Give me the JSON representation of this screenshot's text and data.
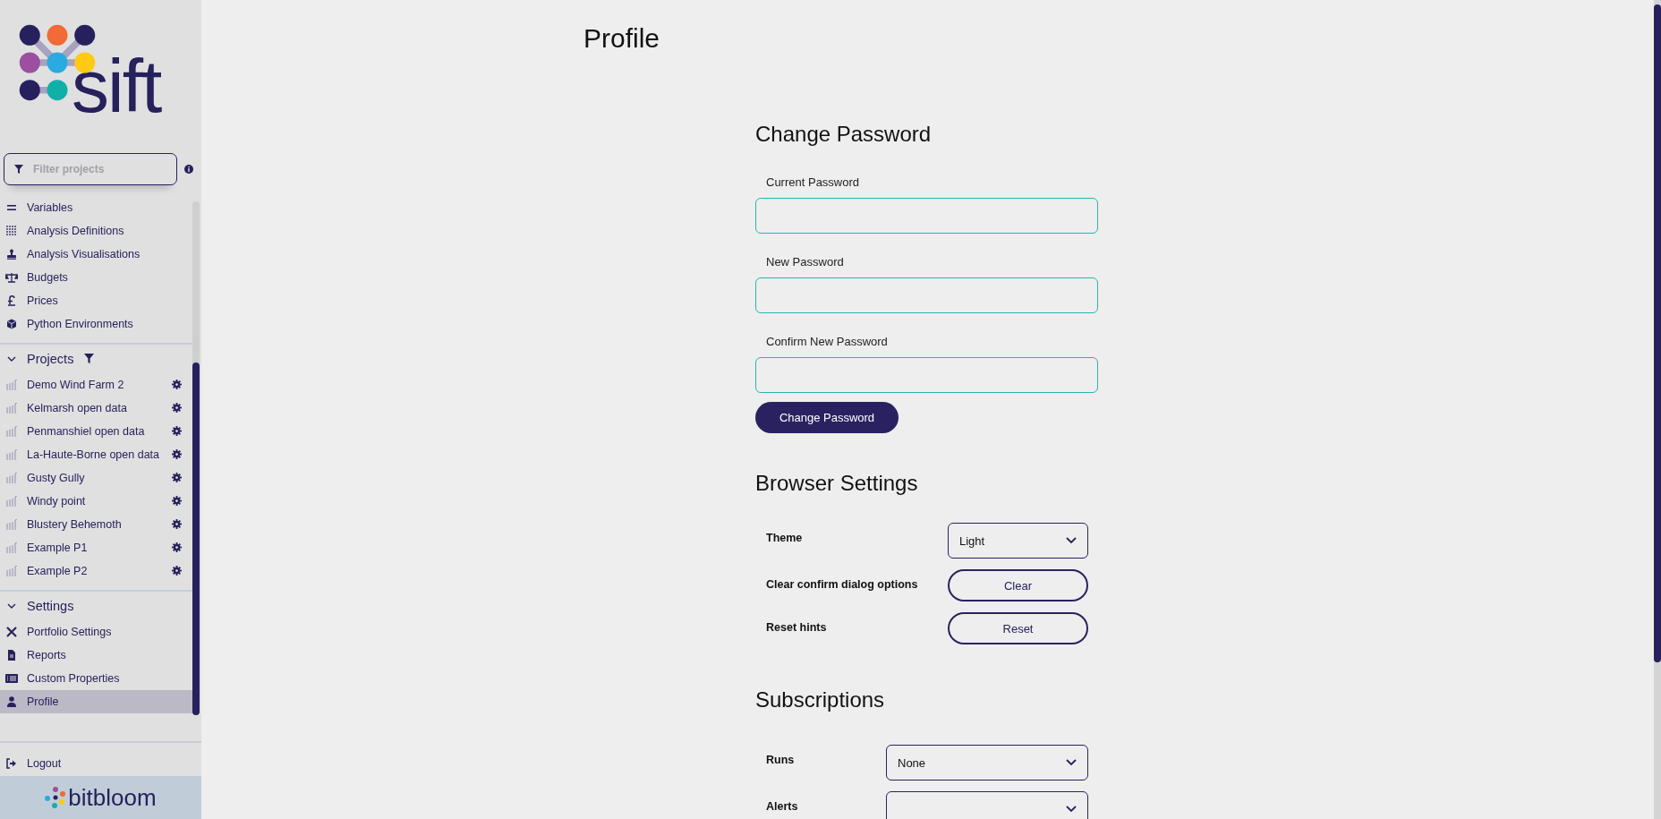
{
  "logo": {
    "text": "sift"
  },
  "filter": {
    "placeholder": "Filter projects"
  },
  "nav_items": [
    {
      "label": "Variables",
      "selected": false
    },
    {
      "label": "Analysis Definitions",
      "selected": false
    },
    {
      "label": "Analysis Visualisations",
      "selected": false
    },
    {
      "label": "Budgets",
      "selected": false
    },
    {
      "label": "Prices",
      "selected": false
    },
    {
      "label": "Python Environments",
      "selected": false
    }
  ],
  "projects": {
    "title": "Projects",
    "expanded": true,
    "items": [
      {
        "label": "Demo Wind Farm 2",
        "selected": false
      },
      {
        "label": "Kelmarsh open data",
        "selected": false
      },
      {
        "label": "Penmanshiel open data",
        "selected": false
      },
      {
        "label": "La-Haute-Borne open data",
        "selected": false
      },
      {
        "label": "Gusty Gully",
        "selected": false
      },
      {
        "label": "Windy point",
        "selected": false
      },
      {
        "label": "Blustery Behemoth",
        "selected": false
      },
      {
        "label": "Example P1",
        "selected": false
      },
      {
        "label": "Example P2",
        "selected": false
      }
    ]
  },
  "settings": {
    "title": "Settings",
    "expanded": true,
    "items": [
      {
        "label": "Portfolio Settings",
        "selected": false
      },
      {
        "label": "Reports",
        "selected": false
      },
      {
        "label": "Custom Properties",
        "selected": false
      },
      {
        "label": "Profile",
        "selected": true
      }
    ]
  },
  "logout": {
    "label": "Logout"
  },
  "footer": {
    "brand": "bitbloom"
  },
  "page_title": "Profile",
  "change_password": {
    "heading": "Change Password",
    "fields": [
      {
        "label": "Current Password"
      },
      {
        "label": "New Password"
      },
      {
        "label": "Confirm New Password"
      }
    ],
    "button": "Change Password"
  },
  "browser_settings": {
    "heading": "Browser Settings",
    "rows": [
      {
        "kind": "select",
        "label": "Theme",
        "value": "Light"
      },
      {
        "kind": "button",
        "label": "Clear confirm dialog options",
        "button": "Clear"
      },
      {
        "kind": "button",
        "label": "Reset hints",
        "button": "Reset"
      }
    ]
  },
  "subscriptions": {
    "heading": "Subscriptions",
    "rows": [
      {
        "label": "Runs",
        "value": "None"
      },
      {
        "label": "Alerts"
      }
    ]
  }
}
